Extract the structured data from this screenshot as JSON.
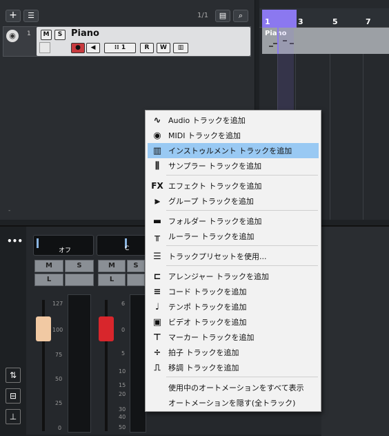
{
  "toolbar": {
    "add_icon": "plus-icon",
    "preset_icon": "track-preset-icon",
    "page_count": "1/1"
  },
  "track": {
    "number": "1",
    "mute_label": "M",
    "solo_label": "S",
    "name": "Piano",
    "midi_channel": "1",
    "read_label": "R",
    "write_label": "W"
  },
  "timeline": {
    "ruler": [
      "1",
      "3",
      "5",
      "7"
    ],
    "part_name": "Piano",
    "locator_color": "#8b78f0"
  },
  "mixer": {
    "more_label": "•••",
    "channels": [
      {
        "slot_label": "オフ",
        "mute_label": "M",
        "solo_label": "S",
        "listen_label": "L",
        "fader_scale": [
          "127",
          "100",
          "75",
          "50",
          "25",
          "0"
        ],
        "fader_color": "#f1c9a3",
        "level": 100
      },
      {
        "slot_label": "C",
        "mute_label": "M",
        "solo_label": "S",
        "listen_label": "L",
        "fader_scale": [
          "6",
          "0",
          "5",
          "10",
          "15",
          "20",
          "30",
          "40",
          "50"
        ],
        "fader_color": "#d8262c",
        "level": 0
      }
    ]
  },
  "menu": {
    "items": [
      {
        "icon": "audio-waveform-icon",
        "glyph": "∿",
        "label": "Audio トラックを追加"
      },
      {
        "icon": "midi-port-icon",
        "glyph": "◉",
        "label": "MIDI トラックを追加"
      },
      {
        "icon": "keyboard-icon",
        "glyph": "▥",
        "label": "インストゥルメント トラックを追加",
        "highlight": true
      },
      {
        "icon": "sampler-icon",
        "glyph": "⫼",
        "label": "サンプラー トラックを追加"
      },
      {
        "icon": "fx-icon",
        "glyph": "FX",
        "label": "エフェクト トラックを追加"
      },
      {
        "icon": "group-icon",
        "glyph": "⫸",
        "label": "グループ トラックを追加"
      },
      {
        "icon": "folder-icon",
        "glyph": "▬",
        "label": "フォルダー トラックを追加"
      },
      {
        "icon": "ruler-icon",
        "glyph": "╥",
        "label": "ルーラー トラックを追加"
      },
      {
        "icon": "preset-icon",
        "glyph": "☰",
        "label": "トラックプリセットを使用..."
      },
      {
        "icon": "arranger-icon",
        "glyph": "⊏",
        "label": "アレンジャー トラックを追加"
      },
      {
        "icon": "chord-icon",
        "glyph": "≡",
        "label": "コード トラックを追加"
      },
      {
        "icon": "tempo-icon",
        "glyph": "♩",
        "label": "テンポ トラックを追加"
      },
      {
        "icon": "video-icon",
        "glyph": "▣",
        "label": "ビデオ トラックを追加"
      },
      {
        "icon": "marker-icon",
        "glyph": "⊤",
        "label": "マーカー トラックを追加"
      },
      {
        "icon": "signature-icon",
        "glyph": "÷",
        "label": "拍子 トラックを追加"
      },
      {
        "icon": "transpose-icon",
        "glyph": "⎍",
        "label": "移調 トラックを追加"
      },
      {
        "icon": "",
        "glyph": "",
        "label": "使用中のオートメーションをすべて表示"
      },
      {
        "icon": "",
        "glyph": "",
        "label": "オートメーションを隠す(全トラック)"
      }
    ]
  }
}
